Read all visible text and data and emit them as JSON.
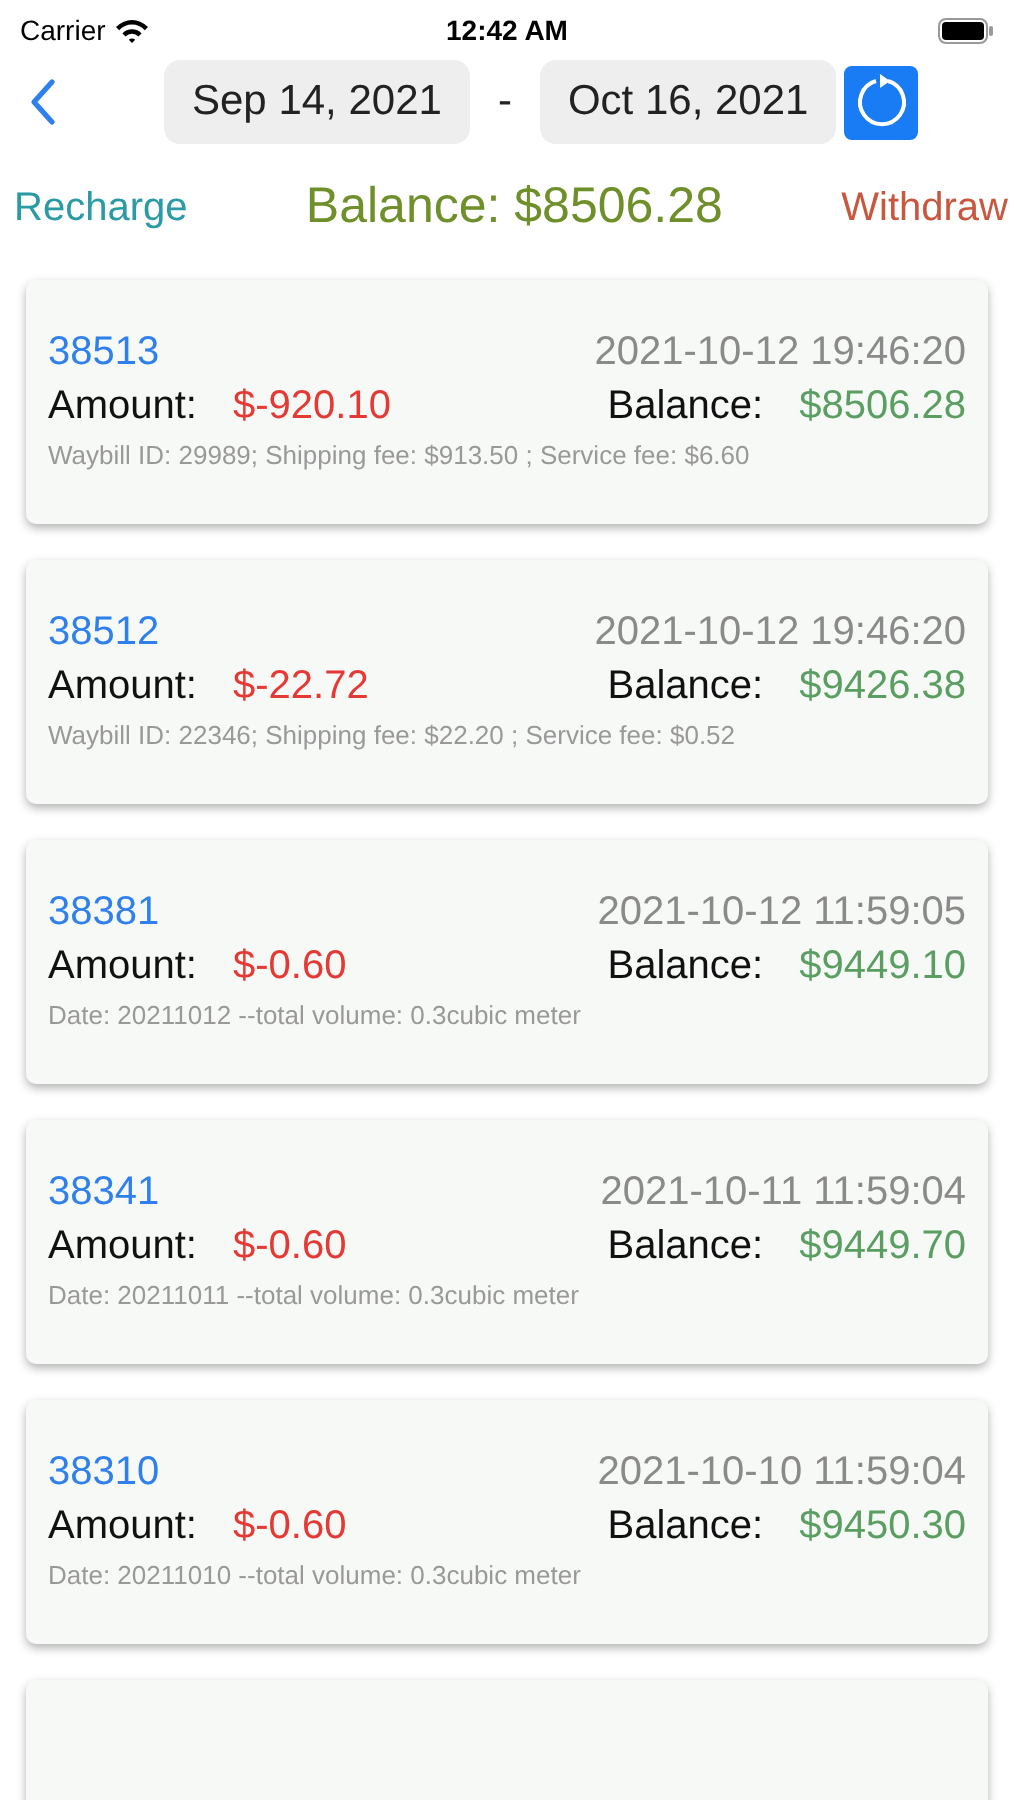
{
  "status_bar": {
    "carrier": "Carrier",
    "time": "12:42 AM"
  },
  "date_range": {
    "start": "Sep 14, 2021",
    "separator": "-",
    "end": "Oct 16, 2021"
  },
  "summary": {
    "recharge": "Recharge",
    "balance": "Balance: $8506.28",
    "withdraw": "Withdraw"
  },
  "transactions": [
    {
      "id": "38513",
      "time": "2021-10-12 19:46:20",
      "amount_label": "Amount:",
      "amount": "$-920.10",
      "balance_label": "Balance:",
      "balance": "$8506.28",
      "note": "Waybill ID: 29989; Shipping fee: $913.50 ; Service fee: $6.60"
    },
    {
      "id": "38512",
      "time": "2021-10-12 19:46:20",
      "amount_label": "Amount:",
      "amount": "$-22.72",
      "balance_label": "Balance:",
      "balance": "$9426.38",
      "note": "Waybill ID: 22346; Shipping fee: $22.20 ; Service fee: $0.52"
    },
    {
      "id": "38381",
      "time": "2021-10-12 11:59:05",
      "amount_label": "Amount:",
      "amount": "$-0.60",
      "balance_label": "Balance:",
      "balance": "$9449.10",
      "note": "Date: 20211012 --total volume: 0.3cubic meter"
    },
    {
      "id": "38341",
      "time": "2021-10-11 11:59:04",
      "amount_label": "Amount:",
      "amount": "$-0.60",
      "balance_label": "Balance:",
      "balance": "$9449.70",
      "note": "Date: 20211011 --total volume: 0.3cubic meter"
    },
    {
      "id": "38310",
      "time": "2021-10-10 11:59:04",
      "amount_label": "Amount:",
      "amount": "$-0.60",
      "balance_label": "Balance:",
      "balance": "$9450.30",
      "note": "Date: 20211010 --total volume: 0.3cubic meter"
    }
  ]
}
